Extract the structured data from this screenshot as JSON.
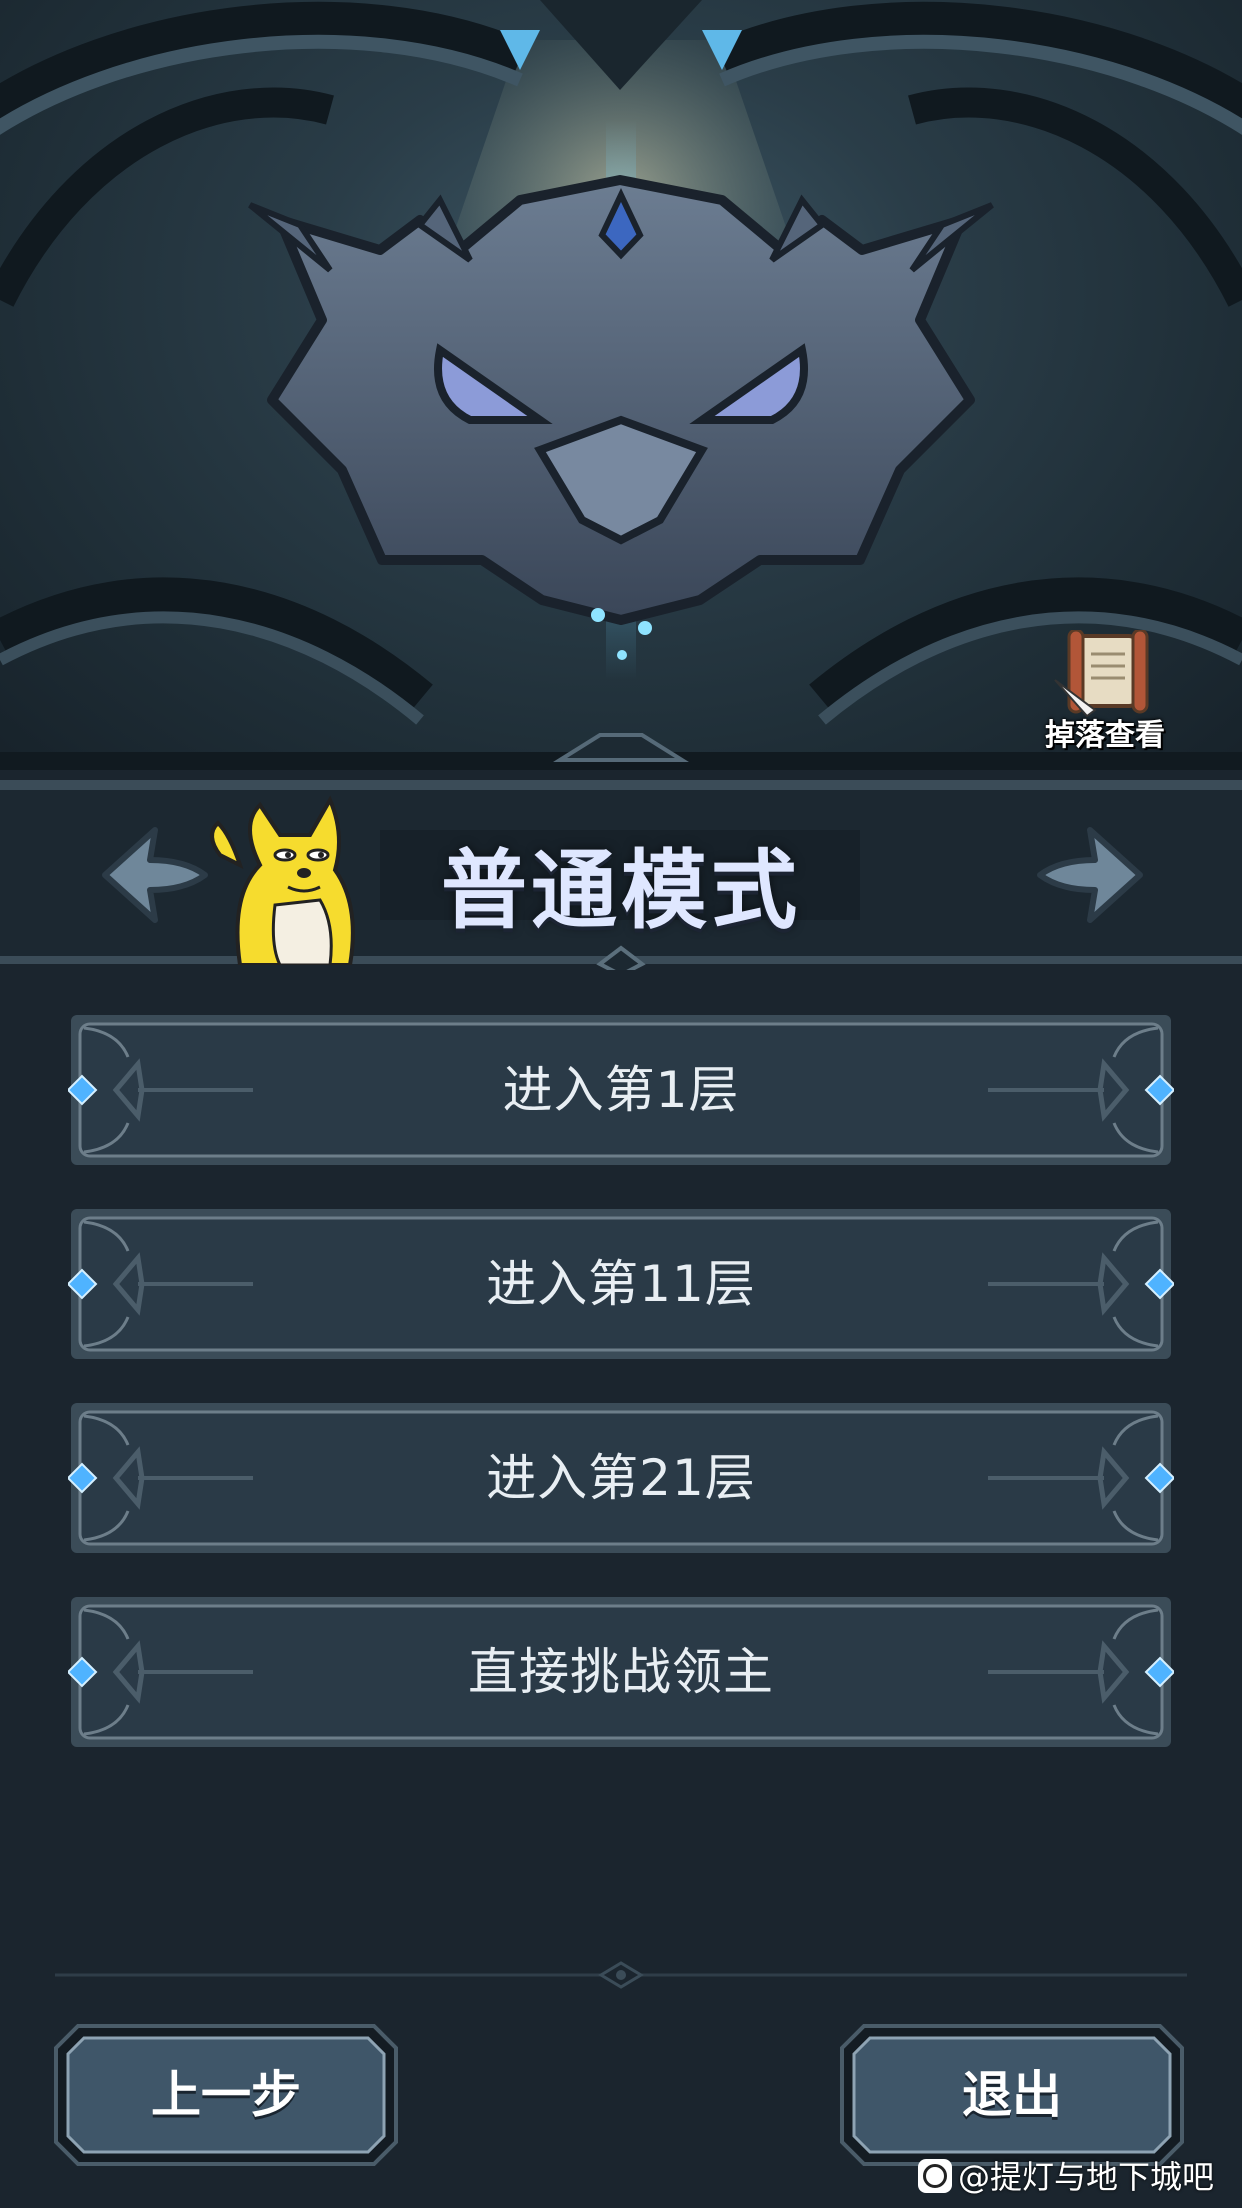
{
  "hero": {
    "drop_view_label": "掉落查看",
    "boss_icon": "horned-mask-emblem"
  },
  "mode": {
    "title": "普通模式",
    "prev_icon": "curved-arrow-left-icon",
    "next_icon": "curved-arrow-right-icon"
  },
  "options": [
    {
      "label": "进入第1层"
    },
    {
      "label": "进入第11层"
    },
    {
      "label": "进入第21层"
    },
    {
      "label": "直接挑战领主"
    }
  ],
  "footer": {
    "prev_label": "上一步",
    "exit_label": "退出"
  },
  "watermark": {
    "text": "@提灯与地下城吧"
  },
  "colors": {
    "background": "#1b252e",
    "button_fill": "#2a3a47",
    "button_border": "#6d7e8a",
    "gem_blue": "#4fb3ff",
    "title_text": "#dfe7ff"
  }
}
